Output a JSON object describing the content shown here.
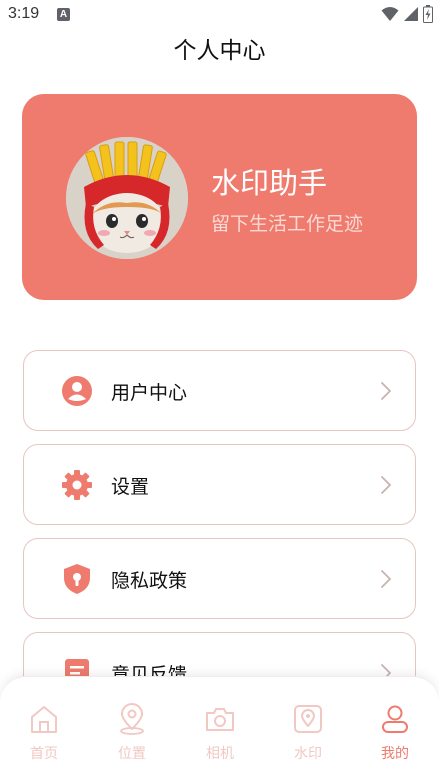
{
  "status_bar": {
    "time": "3:19",
    "notification_badge": "A"
  },
  "header": {
    "title": "个人中心"
  },
  "profile": {
    "name": "水印助手",
    "slogan": "留下生活工作足迹"
  },
  "menu": [
    {
      "label": "用户中心",
      "icon": "user-circle-icon"
    },
    {
      "label": "设置",
      "icon": "gear-icon"
    },
    {
      "label": "隐私政策",
      "icon": "shield-lock-icon"
    },
    {
      "label": "意见反馈",
      "icon": "document-icon"
    }
  ],
  "tabbar": {
    "items": [
      {
        "label": "首页",
        "icon": "home-icon"
      },
      {
        "label": "位置",
        "icon": "location-icon"
      },
      {
        "label": "相机",
        "icon": "camera-icon"
      },
      {
        "label": "水印",
        "icon": "watermark-pin-icon"
      },
      {
        "label": "我的",
        "icon": "person-icon",
        "active": true
      }
    ]
  },
  "colors": {
    "accent": "#ee7b6e",
    "accent_light": "#f1c8c2",
    "card_border": "#e6c6c2"
  }
}
